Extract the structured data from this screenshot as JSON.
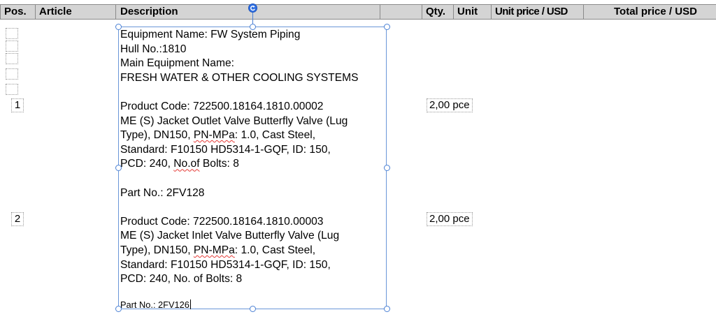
{
  "table": {
    "headers": [
      "Pos.",
      "Article",
      "Description",
      "Qty.",
      "Unit",
      "Unit price / USD",
      "Total price / USD"
    ],
    "rows": [
      {
        "pos": "1",
        "qty": "2,00",
        "unit": "pce"
      },
      {
        "pos": "2",
        "qty": "2,00",
        "unit": "pce"
      }
    ]
  },
  "description": {
    "equipment_name": "Equipment Name: FW System Piping",
    "hull_no": "Hull No.:1810",
    "main_equipment_label": "Main Equipment Name:",
    "main_equipment_value": "FRESH WATER & OTHER COOLING SYSTEMS",
    "items": [
      {
        "product_code": "Product Code: 722500.18164.1810.00002",
        "line1": "ME (S) Jacket Outlet Valve Butterfly Valve (Lug",
        "line2_pre": "Type), DN150, ",
        "line2_err": "PN-MPa",
        "line2_post": ": 1.0, Cast Steel,",
        "line3": "Standard: F10150 HD5314-1-GQF, ID: 150,",
        "line4_pre": "PCD: 240, ",
        "line4_err": "No.of",
        "line4_post": " Bolts: 8",
        "part_no": "Part No.: 2FV128"
      },
      {
        "product_code": "Product Code: 722500.18164.1810.00003",
        "line1": "ME (S) Jacket Inlet Valve Butterfly Valve (Lug",
        "line2_pre": "Type), DN150, ",
        "line2_err": "PN-MPa",
        "line2_post": ": 1.0, Cast Steel,",
        "line3": "Standard: F10150 HD5314-1-GQF, ID: 150,",
        "line4_pre": "PCD: 240, No. of Bolts: 8",
        "part_no": "Part No.: 2FV126"
      }
    ]
  },
  "colors": {
    "header_bg": "#d4d4d4",
    "selection_frame": "#6a96d8",
    "rotation_handle": "#2e6ee0",
    "spellcheck_underline": "#e53935"
  }
}
